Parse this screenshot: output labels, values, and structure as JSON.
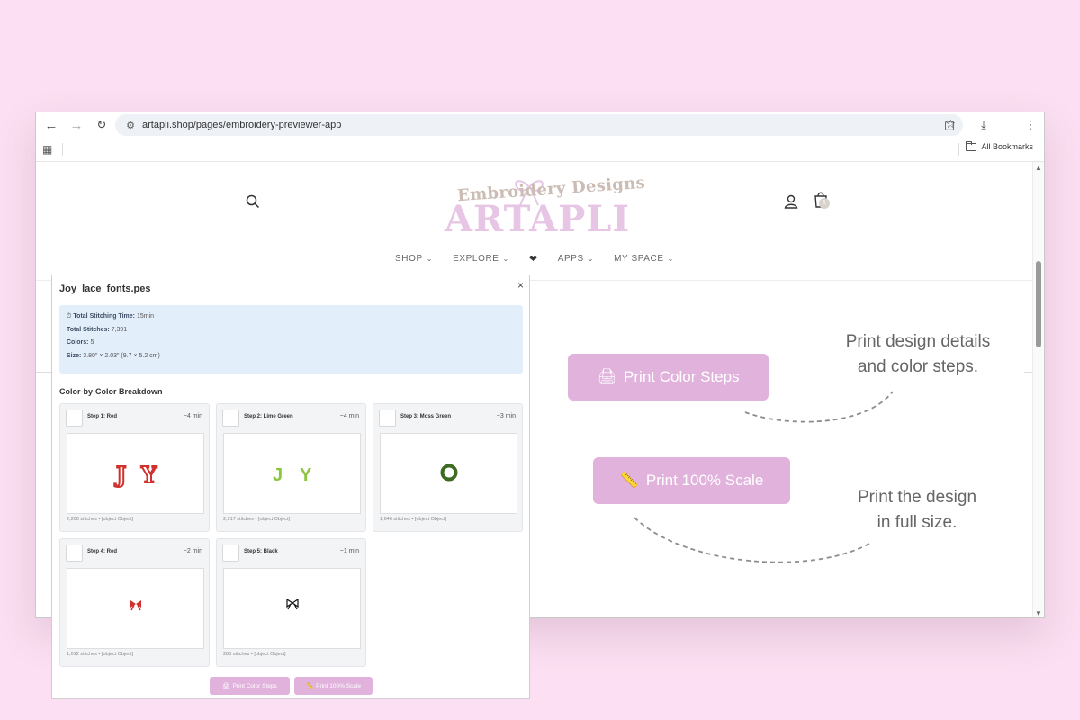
{
  "browser": {
    "url": "artapli.shop/pages/embroidery-previewer-app",
    "bookmarks_label": "All Bookmarks"
  },
  "site": {
    "logo_tagline": "Embroidery Designs",
    "logo_brand": "ARTAPLI",
    "cart_count": "1",
    "nav": [
      {
        "label": "SHOP"
      },
      {
        "label": "EXPLORE"
      },
      {
        "label": "❤"
      },
      {
        "label": "APPS"
      },
      {
        "label": "MY SPACE"
      }
    ]
  },
  "promo": {
    "color_steps_button": "Print Color Steps",
    "full_scale_button": "Print 100% Scale",
    "color_steps_caption_line1": "Print design details",
    "color_steps_caption_line2": "and color steps.",
    "full_scale_caption_line1": "Print the design",
    "full_scale_caption_line2": "in full size."
  },
  "modal": {
    "title": "Joy_lace_fonts.pes",
    "close_label": "×",
    "summary": {
      "time_label": "Total Stitching Time:",
      "time_value": "15min",
      "stitches_label": "Total Stitches:",
      "stitches_value": "7,391",
      "colors_label": "Colors:",
      "colors_value": "5",
      "size_label": "Size:",
      "size_value": "3.80\" × 2.03\" (9.7 × 5.2 cm)"
    },
    "section_title": "Color-by-Color Breakdown",
    "steps": [
      {
        "name": "Step 1: Red",
        "time": "~4 min",
        "stitches": "2,206 stitches",
        "extra": "[object Object]",
        "color": "#d0312d",
        "preview": "J Y"
      },
      {
        "name": "Step 2: Lime Green",
        "time": "~4 min",
        "stitches": "2,217 stitches",
        "extra": "[object Object]",
        "color": "#8cc63f",
        "preview": "J Y"
      },
      {
        "name": "Step 3: Moss Green",
        "time": "~3 min",
        "stitches": "1,646 stitches",
        "extra": "[object Object]",
        "color": "#3d6b22",
        "preview": "wreath"
      },
      {
        "name": "Step 4: Red",
        "time": "~2 min",
        "stitches": "1,012 stitches",
        "extra": "[object Object]",
        "color": "#d0312d",
        "preview": "bow"
      },
      {
        "name": "Step 5: Black",
        "time": "~1 min",
        "stitches": "283 stitches",
        "extra": "[object Object]",
        "color": "#111111",
        "preview": "bow-outline"
      }
    ],
    "print_color_steps_button": "Print Color Steps",
    "print_full_scale_button": "Print 100% Scale"
  }
}
